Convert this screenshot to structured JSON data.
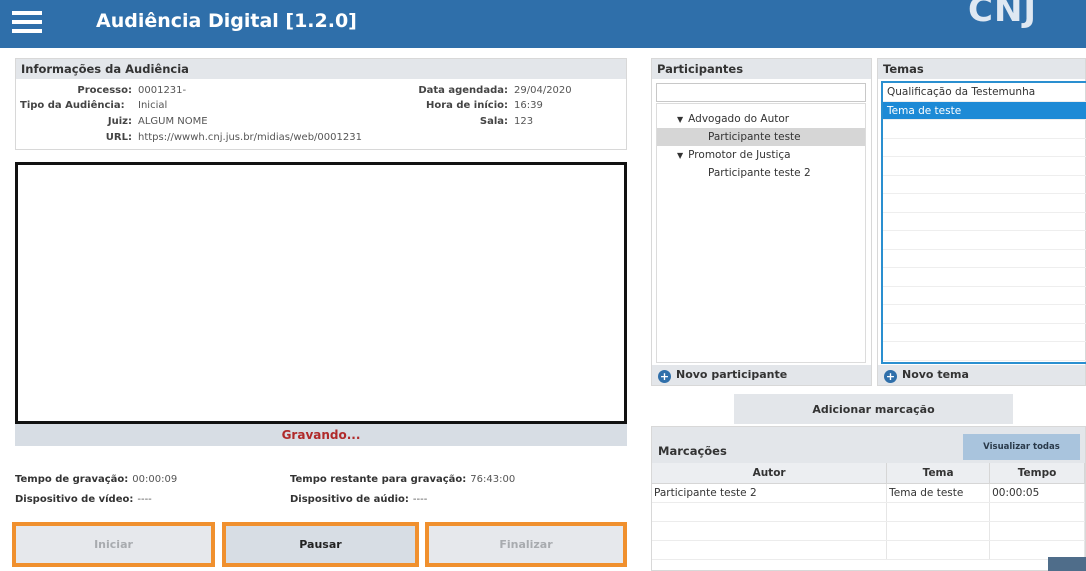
{
  "header": {
    "title": "Audiência Digital [1.2.0]",
    "logo_text": "CNJ",
    "menu_icon": "hamburger-menu-icon"
  },
  "info": {
    "title": "Informações da Audiência",
    "processo_label": "Processo:",
    "processo_value": "0001231-",
    "tipo_label": "Tipo da Audiência:",
    "tipo_value": "Inicial",
    "juiz_label": "Juiz:",
    "juiz_value": "ALGUM NOME",
    "url_label": "URL:",
    "url_value": "https://wwwh.cnj.jus.br/midias/web/0001231",
    "data_label": "Data agendada:",
    "data_value": "29/04/2020",
    "hora_label": "Hora de início:",
    "hora_value": "16:39",
    "sala_label": "Sala:",
    "sala_value": "123"
  },
  "recording": {
    "status": "Gravando...",
    "tempo_label": "Tempo de gravação:",
    "tempo_value": "00:00:09",
    "restante_label": "Tempo restante para gravação:",
    "restante_value": "76:43:00",
    "video_label": "Dispositivo de vídeo:",
    "video_value": "----",
    "audio_label": "Dispositivo de aúdio:",
    "audio_value": "----"
  },
  "controls": {
    "iniciar": "Iniciar",
    "pausar": "Pausar",
    "finalizar": "Finalizar"
  },
  "participantes": {
    "title": "Participantes",
    "search_value": "",
    "tree": [
      {
        "label": "Advogado do Autor",
        "children": [
          "Participante teste"
        ]
      },
      {
        "label": "Promotor de Justiça",
        "children": [
          "Participante teste 2"
        ]
      }
    ],
    "footer": "Novo participante"
  },
  "temas": {
    "title": "Temas",
    "items": [
      "Qualificação da Testemunha",
      "Tema de teste"
    ],
    "selected_index": 1,
    "footer": "Novo tema"
  },
  "add_marcacao": "Adicionar marcação",
  "marcacoes": {
    "title": "Marcações",
    "view_all": "Visualizar todas",
    "columns": [
      "Autor",
      "Tema",
      "Tempo"
    ],
    "rows": [
      [
        "Participante teste 2",
        "Tema de teste",
        "00:00:05"
      ]
    ]
  },
  "colors": {
    "header": "#2f6faa",
    "recording": "#b02a2a",
    "highlight_border": "#f0902e",
    "selection": "#1d8ad6"
  }
}
